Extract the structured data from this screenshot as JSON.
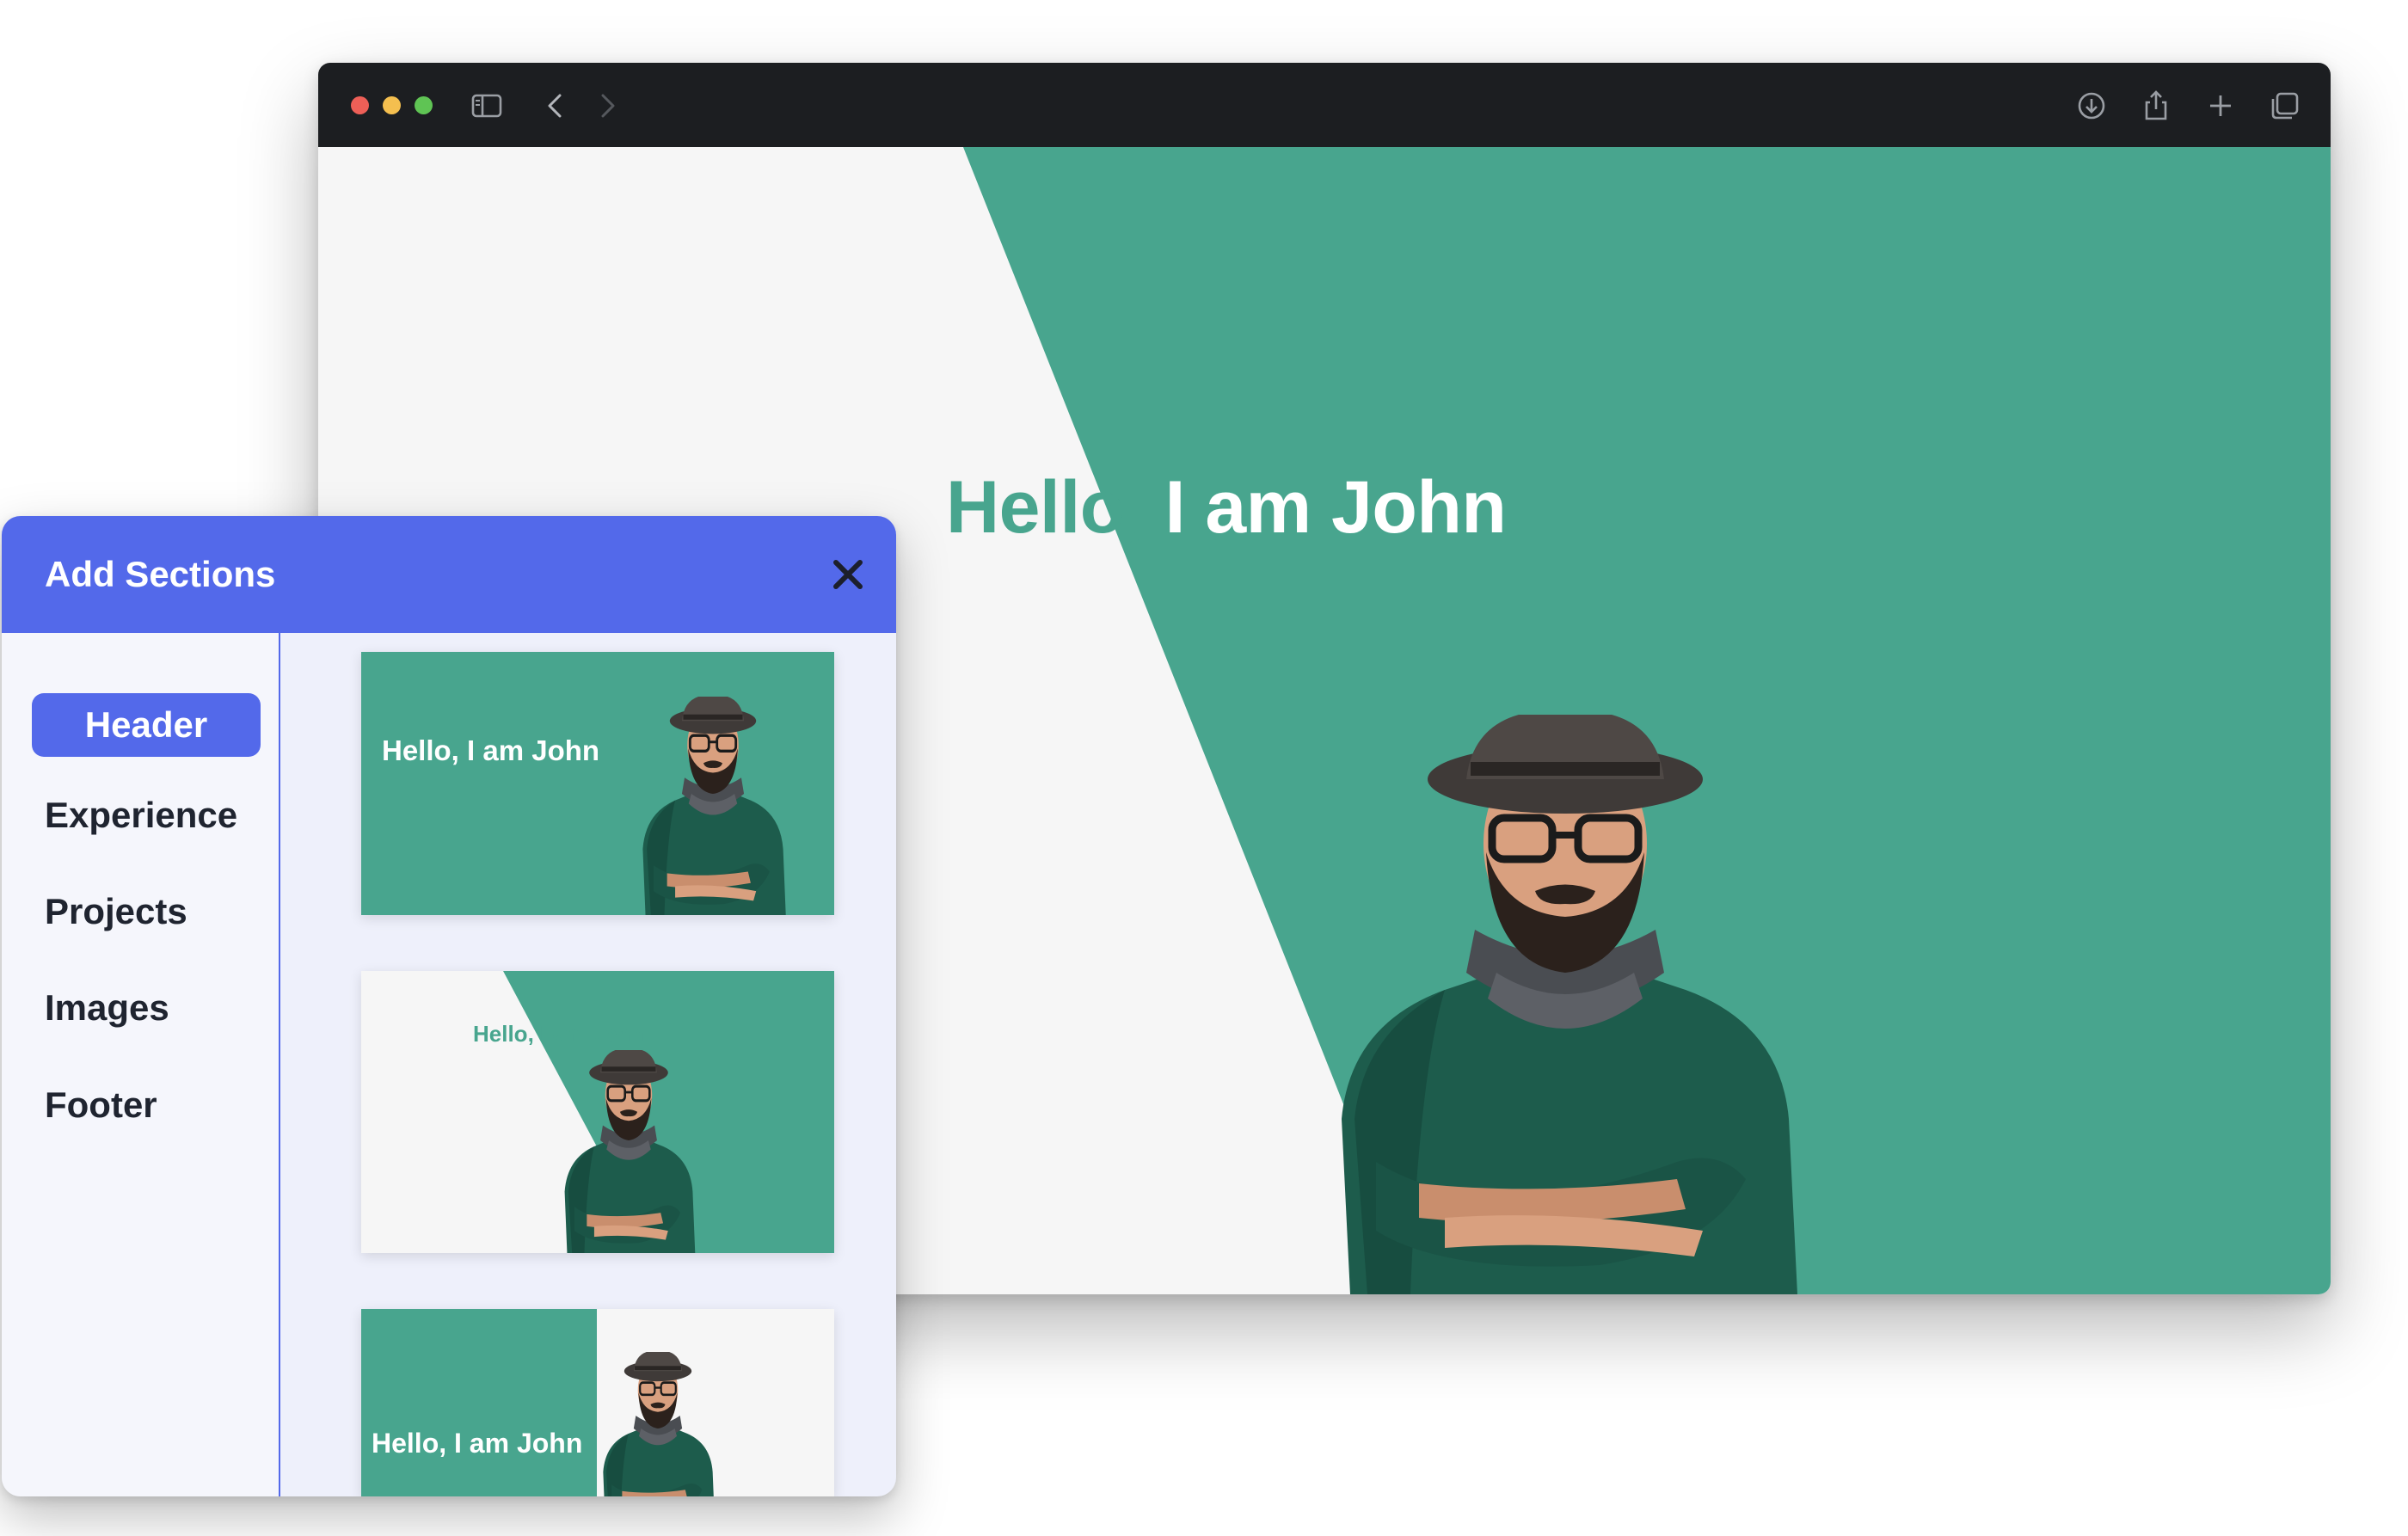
{
  "browser": {
    "toolbar": {
      "icons": [
        "sidebar-icon",
        "back-chevron-icon",
        "forward-chevron-icon",
        "download-icon",
        "share-icon",
        "new-tab-plus-icon",
        "tab-overview-icon"
      ]
    },
    "hero": {
      "title_part1": "Hello,",
      "title_part2": " I am John"
    }
  },
  "panel": {
    "title": "Add Sections",
    "close_icon": "close-icon",
    "nav": [
      {
        "label": "Header",
        "active": true
      },
      {
        "label": "Experience",
        "active": false
      },
      {
        "label": "Projects",
        "active": false
      },
      {
        "label": "Images",
        "active": false
      },
      {
        "label": "Footer",
        "active": false
      }
    ],
    "templates": [
      {
        "title": "Hello, I am John",
        "style": "solid-green"
      },
      {
        "title": "Hello, I am John",
        "style": "diagonal-split"
      },
      {
        "title": "Hello, I am John",
        "style": "left-block"
      }
    ]
  },
  "colors": {
    "accent_blue": "#5369ea",
    "teal": "#48a58e",
    "toolbar_dark": "#1c1e21",
    "page_bg": "#f6f6f6"
  }
}
